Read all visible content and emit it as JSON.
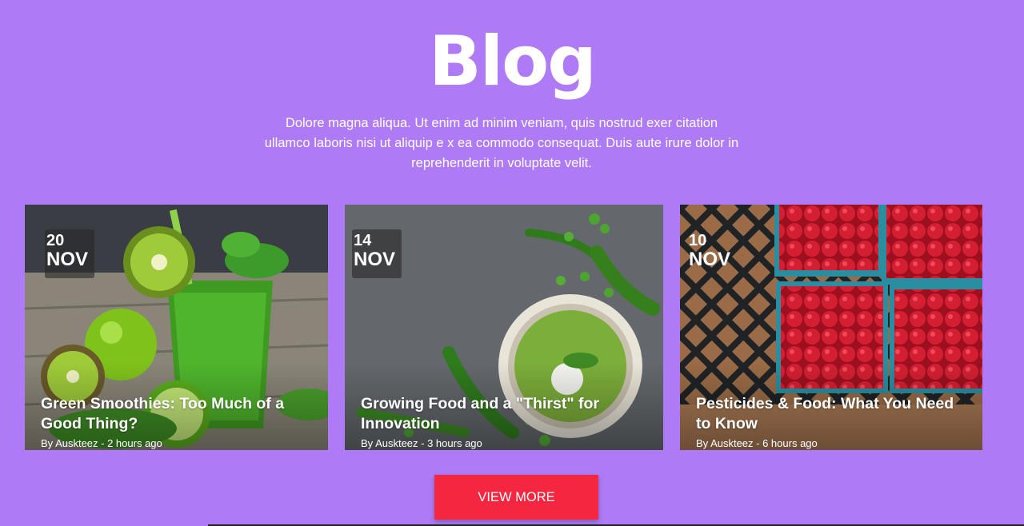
{
  "header": {
    "title": "Blog",
    "intro": "Dolore magna aliqua. Ut enim ad minim veniam, quis nostrud exer citation ullamco laboris nisi ut aliquip e x ea commodo consequat. Duis aute irure dolor in reprehenderit in voluptate velit."
  },
  "posts": [
    {
      "day": "20",
      "month": "NOV",
      "title": "Green Smoothies: Too Much of a Good Thing?",
      "meta": "By Auskteez - 2 hours ago",
      "image": "green smoothie with kiwi, apples and lime"
    },
    {
      "day": "14",
      "month": "NOV",
      "title": "Growing Food and a \"Thirst\" for Innovation",
      "meta": "By Auskteez - 3 hours ago",
      "image": "bowl of pea soup with pea pods on slate"
    },
    {
      "day": "10",
      "month": "NOV",
      "title": "Pesticides & Food: What You Need to Know",
      "meta": "By Auskteez - 6 hours ago",
      "image": "raspberries in blue crates"
    }
  ],
  "actions": {
    "view_more": "VIEW MORE"
  },
  "colors": {
    "background": "#ae7af6",
    "button": "#f42640"
  }
}
